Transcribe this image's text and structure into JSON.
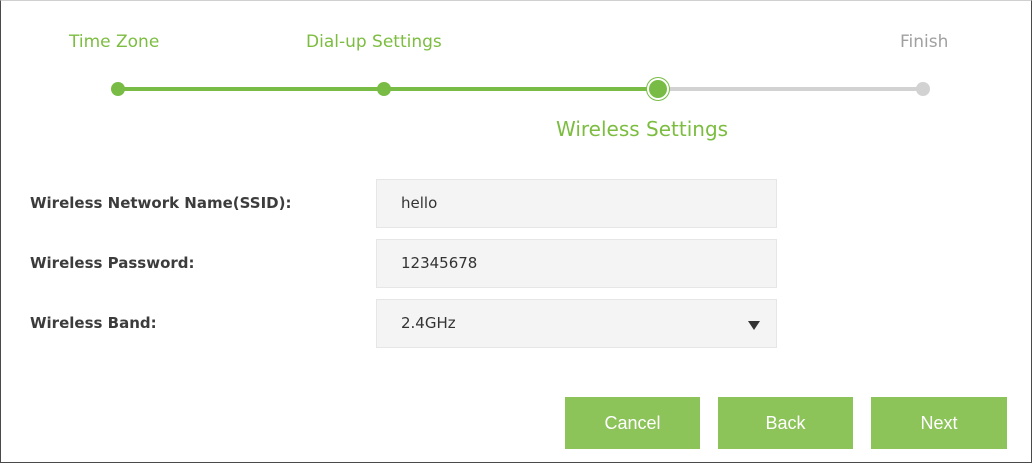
{
  "wizard": {
    "steps": [
      {
        "label": "Time Zone"
      },
      {
        "label": "Dial-up Settings"
      },
      {
        "label": "Wireless Settings"
      },
      {
        "label": "Finish"
      }
    ],
    "current_step_label": "Wireless Settings"
  },
  "form": {
    "ssid": {
      "label": "Wireless Network Name(SSID):",
      "value": "hello"
    },
    "password": {
      "label": "Wireless Password:",
      "value": "12345678"
    },
    "band": {
      "label": "Wireless Band:",
      "value": "2.4GHz"
    }
  },
  "buttons": {
    "cancel": "Cancel",
    "back": "Back",
    "next": "Next"
  },
  "colors": {
    "accent": "#78bc45",
    "button": "#8cc45a",
    "inactive": "#d2d2d2"
  }
}
